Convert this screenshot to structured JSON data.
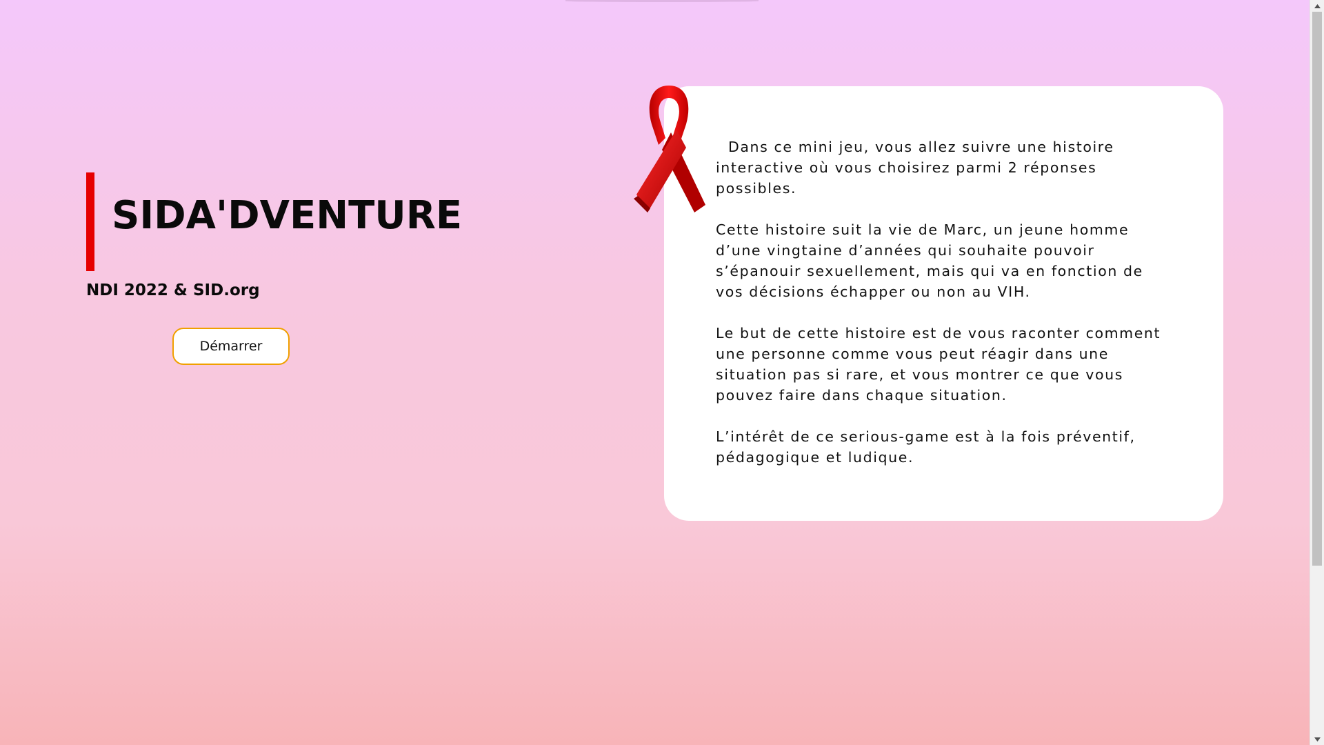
{
  "hero": {
    "title": "SIDA'DVENTURE",
    "subtitle": "NDI 2022 & SID.org",
    "start_button": "Démarrer"
  },
  "card": {
    "paragraphs": [
      "Dans ce mini jeu, vous allez suivre une histoire interactive où vous choisirez parmi 2 réponses possibles.",
      "Cette histoire suit la vie de Marc, un jeune homme d’une vingtaine d’années qui souhaite pouvoir s’épanouir sexuellement, mais qui va en fonction de vos décisions échapper ou non au VIH.",
      "Le but de cette histoire est de vous raconter comment une personne comme vous peut réagir dans une situation pas si rare, et vous montrer ce que vous pouvez faire dans chaque situation.",
      "L’intérêt de ce serious-game est à la fois préventif, pédagogique et ludique."
    ]
  },
  "icons": {
    "ribbon": "red-awareness-ribbon-icon",
    "scroll_up": "chevron-up-icon",
    "scroll_down": "chevron-down-icon"
  },
  "colors": {
    "accent_red": "#e60000",
    "button_border": "#f0a000",
    "background_top": "#f4c8fb",
    "background_bottom": "#f8b4b8"
  }
}
